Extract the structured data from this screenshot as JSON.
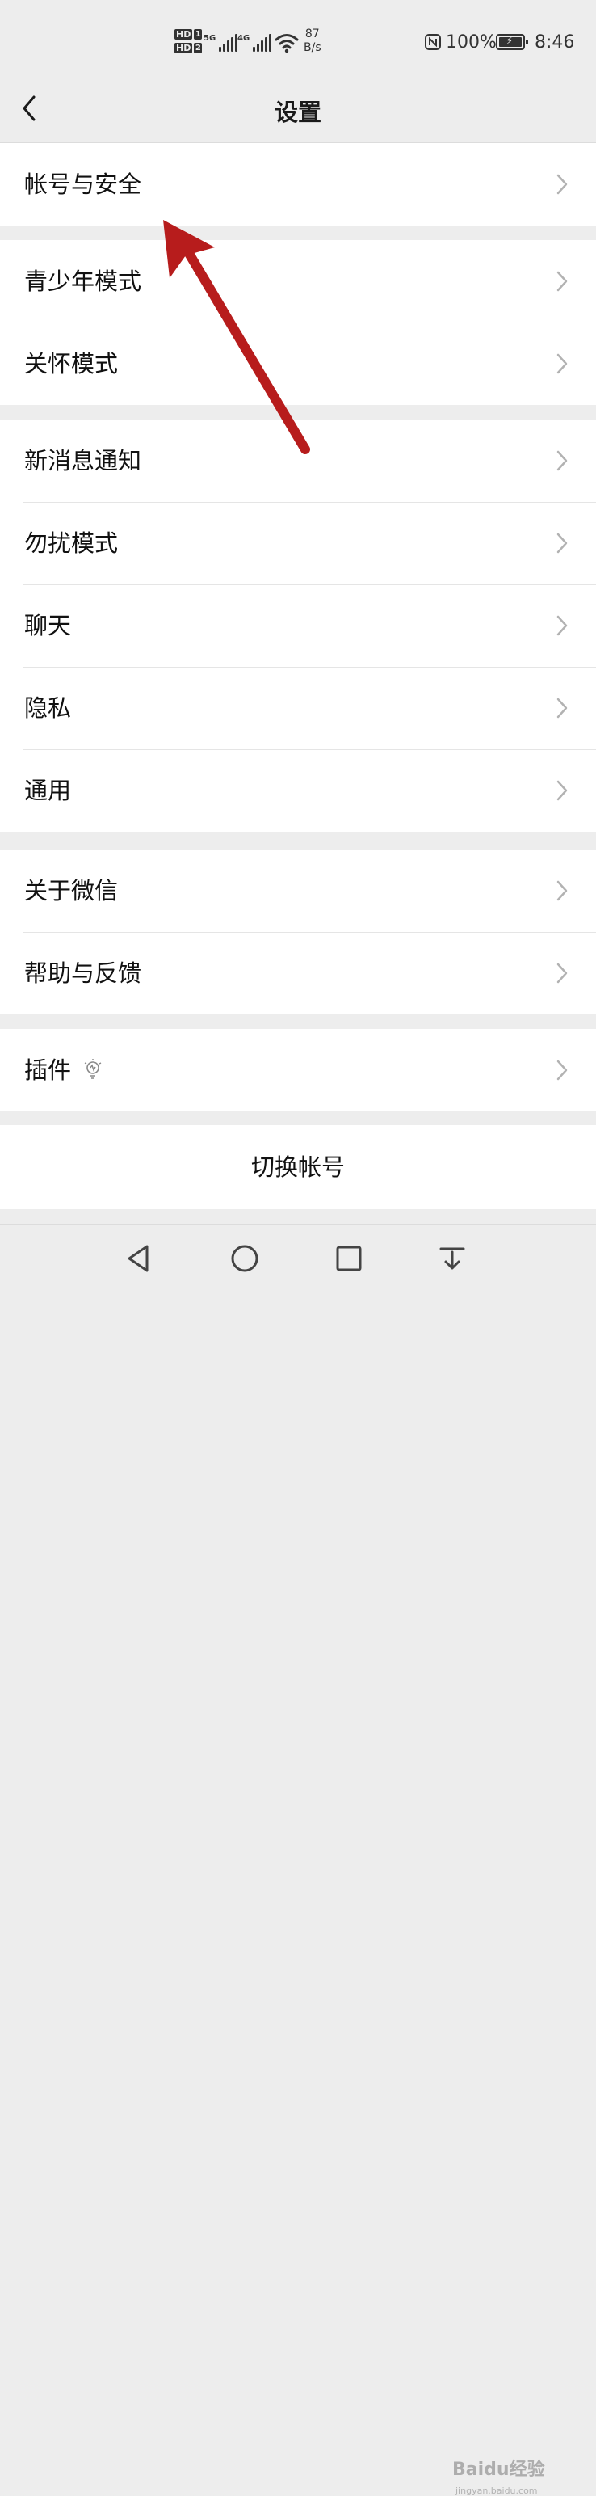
{
  "status_bar": {
    "hd1": "HD",
    "hd1_num": "1",
    "hd2": "HD",
    "hd2_num": "2",
    "network1": "5G",
    "network2": "4G",
    "speed_value": "87",
    "speed_unit": "B/s",
    "battery_percent": "100%",
    "time": "8:46"
  },
  "header": {
    "title": "设置",
    "back_icon": "chevron-left-icon"
  },
  "groups": [
    {
      "items": [
        {
          "label": "帐号与安全"
        }
      ]
    },
    {
      "items": [
        {
          "label": "青少年模式"
        },
        {
          "label": "关怀模式"
        }
      ]
    },
    {
      "items": [
        {
          "label": "新消息通知"
        },
        {
          "label": "勿扰模式"
        },
        {
          "label": "聊天"
        },
        {
          "label": "隐私"
        },
        {
          "label": "通用"
        }
      ]
    },
    {
      "items": [
        {
          "label": "关于微信"
        },
        {
          "label": "帮助与反馈"
        }
      ]
    },
    {
      "items": [
        {
          "label": "插件",
          "icon": "lightbulb-icon"
        }
      ]
    }
  ],
  "switch_account": "切换帐号",
  "annotation": {
    "color": "#b71c1c"
  },
  "watermark": {
    "main": "Baidu经验",
    "sub": "jingyan.baidu.com"
  },
  "colors": {
    "background": "#ededed",
    "row": "#ffffff",
    "text": "#111111",
    "chevron": "#b2b2b2"
  }
}
